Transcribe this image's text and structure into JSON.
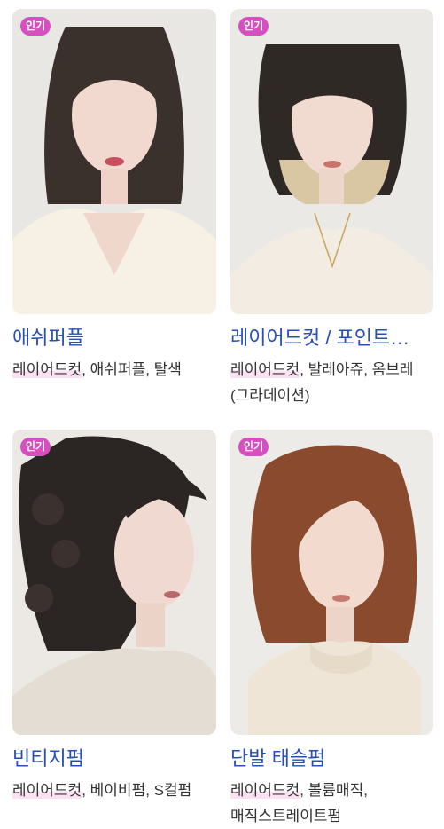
{
  "badge_label": "인기",
  "cards": [
    {
      "title": "애쉬퍼플",
      "tag_highlight": "레이어드컷",
      "tags_rest": ", 애쉬퍼플, 탈색"
    },
    {
      "title": "레이어드컷 / 포인트…",
      "tag_highlight": "레이어드컷",
      "tags_rest": ", 발레아쥬, 옴브레(그라데이션)"
    },
    {
      "title": "빈티지펌",
      "tag_highlight": "레이어드컷",
      "tags_rest": ", 베이비펌, S컬펌"
    },
    {
      "title": "단발 태슬펌",
      "tag_highlight": "레이어드컷",
      "tags_rest": ", 볼륨매직, 매직스트레이트펌"
    }
  ],
  "colors": {
    "title": "#2750b5",
    "badge": "#d64fc0",
    "highlight": "#fbe1f3"
  }
}
